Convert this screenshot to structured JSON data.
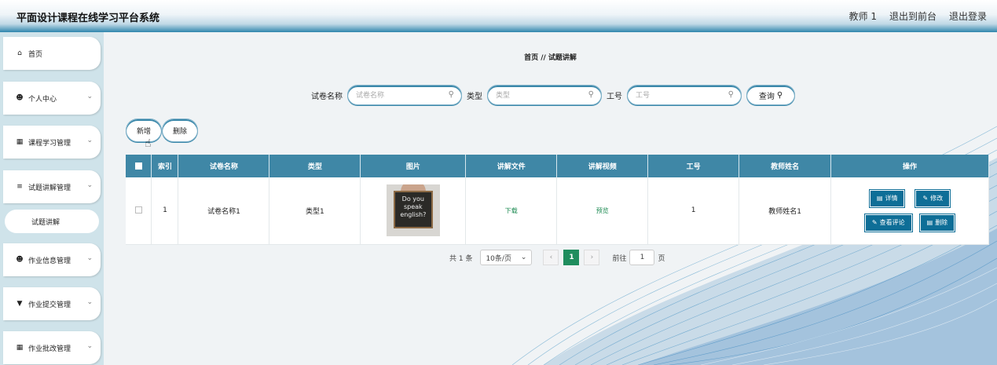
{
  "header": {
    "title": "平面设计课程在线学习平台系统",
    "user": "教师 1",
    "back_to_front": "退出到前台",
    "logout": "退出登录"
  },
  "sidebar": {
    "items": [
      {
        "label": "首页",
        "icon": "home-icon"
      },
      {
        "label": "个人中心",
        "icon": "person-icon"
      },
      {
        "label": "课程学习管理",
        "icon": "grid-icon"
      },
      {
        "label": "试题讲解管理",
        "icon": "list-icon"
      },
      {
        "label": "作业信息管理",
        "icon": "person-icon"
      },
      {
        "label": "作业提交管理",
        "icon": "pin-icon"
      },
      {
        "label": "作业批改管理",
        "icon": "grid-icon"
      }
    ],
    "sub_item": "试题讲解"
  },
  "breadcrumb": "首页 // 试题讲解",
  "search": {
    "paper_label": "试卷名称",
    "paper_placeholder": "试卷名称",
    "type_label": "类型",
    "type_placeholder": "类型",
    "id_label": "工号",
    "id_placeholder": "工号",
    "query_label": "查询"
  },
  "actions": {
    "add": "新增",
    "delete": "删除"
  },
  "table": {
    "headers": [
      "索引",
      "试卷名称",
      "类型",
      "图片",
      "讲解文件",
      "讲解视频",
      "工号",
      "教师姓名",
      "操作"
    ],
    "row": {
      "index": "1",
      "paper": "试卷名称1",
      "type": "类型1",
      "image_text": "Do you speak english?",
      "file": "下载",
      "video": "预览",
      "id": "1",
      "teacher": "教师姓名1",
      "ops": {
        "detail": "详情",
        "edit": "修改",
        "comments": "查看评论",
        "delete": "删除"
      }
    }
  },
  "pagination": {
    "total": "共 1 条",
    "page_size": "10条/页",
    "current": "1",
    "goto_label": "前往",
    "goto_value": "1",
    "page_unit": "页"
  }
}
